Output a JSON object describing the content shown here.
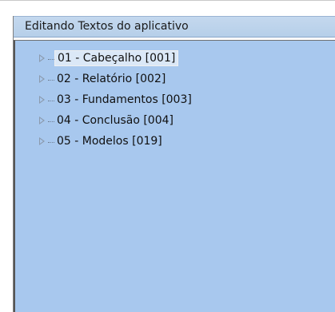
{
  "panel": {
    "title": "Editando Textos do aplicativo"
  },
  "tree": {
    "items": [
      {
        "label": "01 - Cabeçalho [001]",
        "focused": true
      },
      {
        "label": "02 - Relatório [002]",
        "focused": false
      },
      {
        "label": "03 - Fundamentos [003]",
        "focused": false
      },
      {
        "label": "04 - Conclusão [004]",
        "focused": false
      },
      {
        "label": "05 - Modelos [019]",
        "focused": false
      }
    ]
  },
  "colors": {
    "tree_background": "#a8c8ee",
    "header_background": "#bcd3ec",
    "focus_background": "#dbe8f7"
  },
  "icons": {
    "expander": "triangle-right-icon"
  }
}
